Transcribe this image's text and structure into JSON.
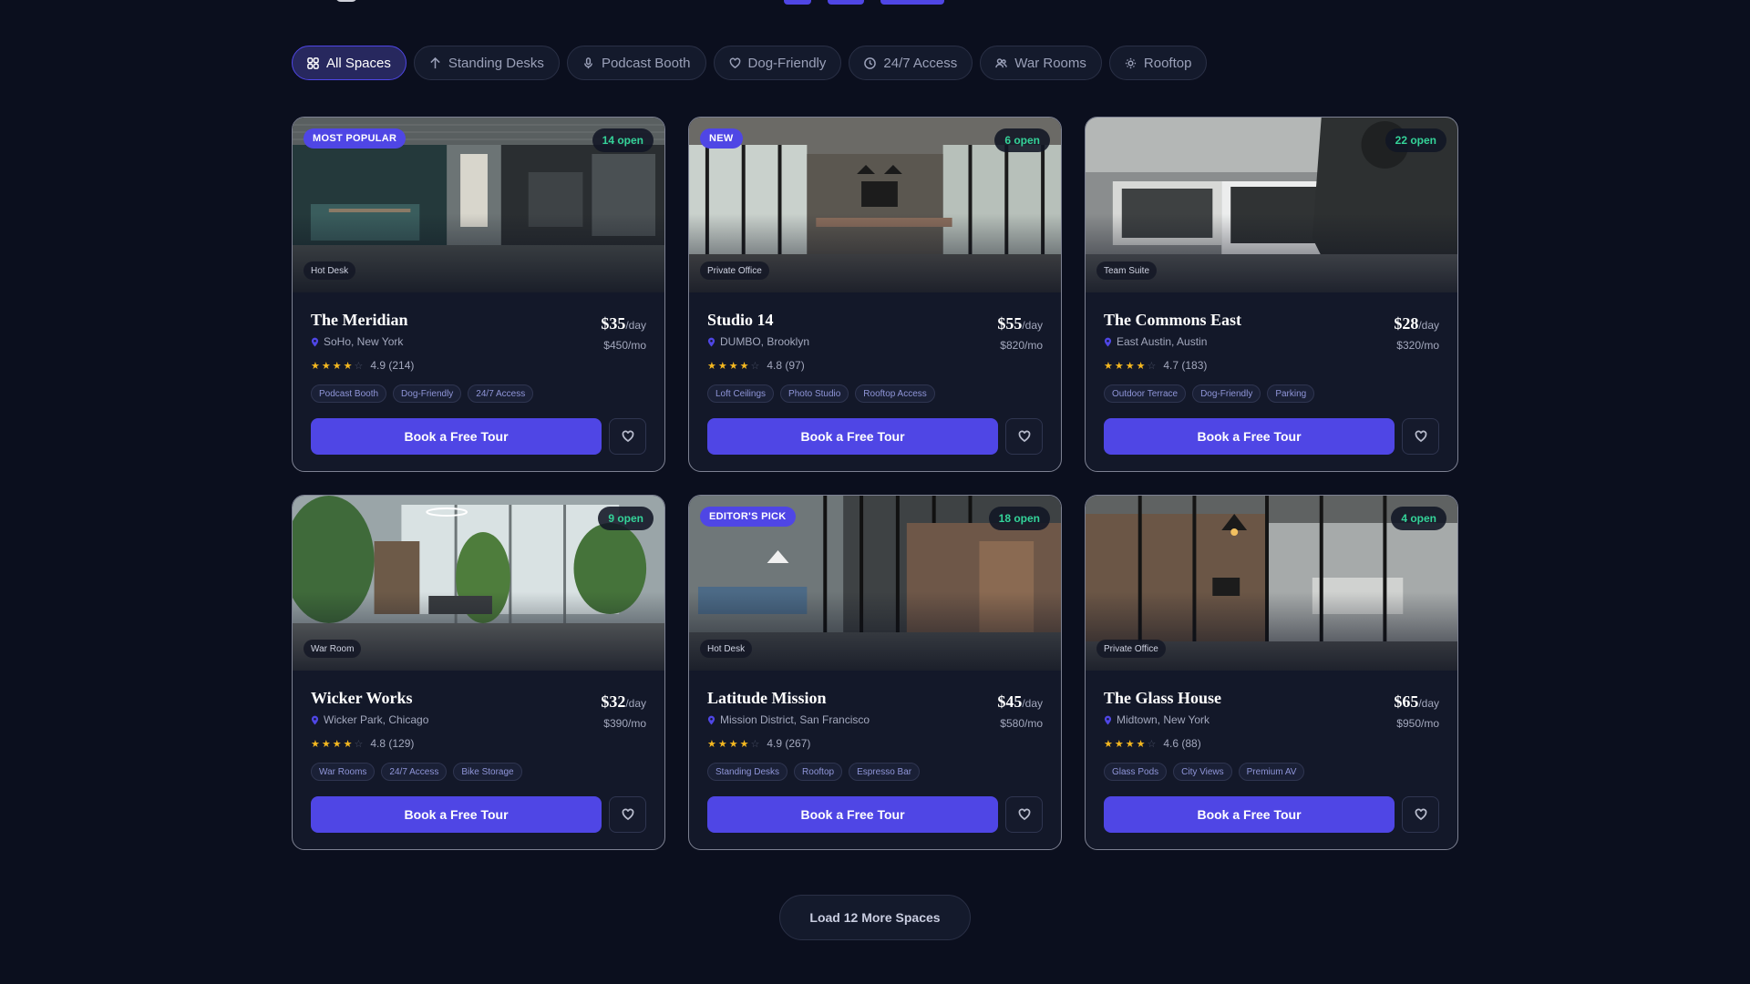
{
  "filters": [
    {
      "label": "All Spaces",
      "icon": "grid-icon",
      "active": true
    },
    {
      "label": "Standing Desks",
      "icon": "arrow-up-icon",
      "active": false
    },
    {
      "label": "Podcast Booth",
      "icon": "mic-icon",
      "active": false
    },
    {
      "label": "Dog-Friendly",
      "icon": "heart-icon",
      "active": false
    },
    {
      "label": "24/7 Access",
      "icon": "clock-icon",
      "active": false
    },
    {
      "label": "War Rooms",
      "icon": "users-icon",
      "active": false
    },
    {
      "label": "Rooftop",
      "icon": "sun-icon",
      "active": false
    }
  ],
  "cards": [
    {
      "name": "The Meridian",
      "location": "SoHo, New York",
      "price_day": "$35",
      "per_day": "/day",
      "price_month": "$450/mo",
      "rating": "4.9 (214)",
      "stars": 4,
      "tags": [
        "Podcast Booth",
        "Dog-Friendly",
        "24/7 Access"
      ],
      "badge": "MOST POPULAR",
      "open": "14 open",
      "type": "Hot Desk",
      "cta": "Book a Free Tour"
    },
    {
      "name": "Studio 14",
      "location": "DUMBO, Brooklyn",
      "price_day": "$55",
      "per_day": "/day",
      "price_month": "$820/mo",
      "rating": "4.8 (97)",
      "stars": 4,
      "tags": [
        "Loft Ceilings",
        "Photo Studio",
        "Rooftop Access"
      ],
      "badge": "NEW",
      "open": "6 open",
      "type": "Private Office",
      "cta": "Book a Free Tour"
    },
    {
      "name": "The Commons East",
      "location": "East Austin, Austin",
      "price_day": "$28",
      "per_day": "/day",
      "price_month": "$320/mo",
      "rating": "4.7 (183)",
      "stars": 4,
      "tags": [
        "Outdoor Terrace",
        "Dog-Friendly",
        "Parking"
      ],
      "badge": "",
      "open": "22 open",
      "type": "Team Suite",
      "cta": "Book a Free Tour"
    },
    {
      "name": "Wicker Works",
      "location": "Wicker Park, Chicago",
      "price_day": "$32",
      "per_day": "/day",
      "price_month": "$390/mo",
      "rating": "4.8 (129)",
      "stars": 4,
      "tags": [
        "War Rooms",
        "24/7 Access",
        "Bike Storage"
      ],
      "badge": "",
      "open": "9 open",
      "type": "War Room",
      "cta": "Book a Free Tour"
    },
    {
      "name": "Latitude Mission",
      "location": "Mission District, San Francisco",
      "price_day": "$45",
      "per_day": "/day",
      "price_month": "$580/mo",
      "rating": "4.9 (267)",
      "stars": 4,
      "tags": [
        "Standing Desks",
        "Rooftop",
        "Espresso Bar"
      ],
      "badge": "EDITOR'S PICK",
      "open": "18 open",
      "type": "Hot Desk",
      "cta": "Book a Free Tour"
    },
    {
      "name": "The Glass House",
      "location": "Midtown, New York",
      "price_day": "$65",
      "per_day": "/day",
      "price_month": "$950/mo",
      "rating": "4.6 (88)",
      "stars": 4,
      "tags": [
        "Glass Pods",
        "City Views",
        "Premium AV"
      ],
      "badge": "",
      "open": "4 open",
      "type": "Private Office",
      "cta": "Book a Free Tour"
    }
  ],
  "load_more": "Load 12 More Spaces",
  "colors": {
    "accent": "#4f46e5",
    "open": "#34d399",
    "star": "#f5b820",
    "background": "#0b0f1e"
  }
}
